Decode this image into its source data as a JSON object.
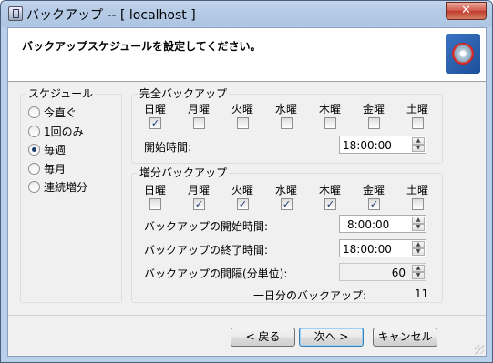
{
  "window": {
    "title": "バックアップ -- [ localhost ]",
    "close_glyph": "✕"
  },
  "header": {
    "text": "バックアップスケジュールを設定してください。",
    "logo_icon": "backup-disc-icon"
  },
  "schedule": {
    "legend": "スケジュール",
    "options": [
      {
        "label": "今直ぐ",
        "checked": false
      },
      {
        "label": "1回のみ",
        "checked": false
      },
      {
        "label": "毎週",
        "checked": true
      },
      {
        "label": "毎月",
        "checked": false
      },
      {
        "label": "連続増分",
        "checked": false
      }
    ]
  },
  "full_backup": {
    "legend": "完全バックアップ",
    "days": [
      "日曜",
      "月曜",
      "火曜",
      "水曜",
      "木曜",
      "金曜",
      "土曜"
    ],
    "checked": [
      true,
      false,
      false,
      false,
      false,
      false,
      false
    ],
    "start_label": "開始時間:",
    "start_time": "18:00:00"
  },
  "incremental_backup": {
    "legend": "増分バックアップ",
    "days": [
      "日曜",
      "月曜",
      "火曜",
      "水曜",
      "木曜",
      "金曜",
      "土曜"
    ],
    "checked": [
      false,
      true,
      true,
      true,
      true,
      true,
      false
    ],
    "start_label": "バックアップの開始時間:",
    "start_time": "8:00:00",
    "end_label": "バックアップの終了時間:",
    "end_time": "18:00:00",
    "interval_label": "バックアップの間隔(分単位):",
    "interval_value": "60",
    "per_day_label": "一日分のバックアップ:",
    "per_day_value": "11"
  },
  "buttons": {
    "back": "< 戻る",
    "next": "次へ >",
    "cancel": "キャンセル"
  },
  "check_glyph": "✓"
}
